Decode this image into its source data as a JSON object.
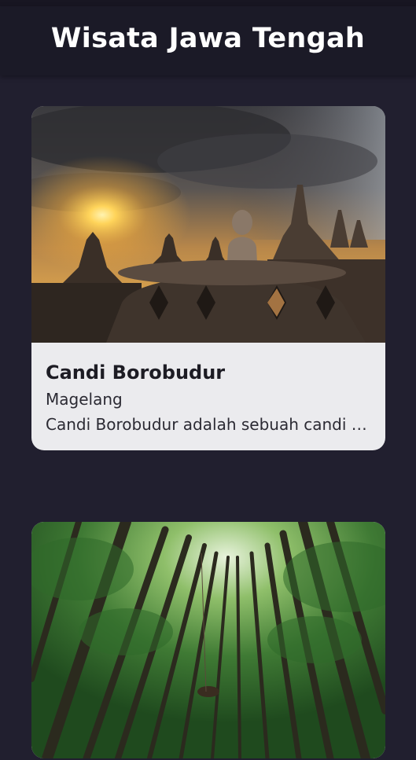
{
  "appbar": {
    "title": "Wisata Jawa Tengah"
  },
  "places": [
    {
      "name": "Candi Borobudur",
      "location": "Magelang",
      "description": "Candi Borobudur adalah sebuah candi Buddha yang terletak di Magelang, Jawa Tengah",
      "image": "borobudur-temple-sunset-photo"
    },
    {
      "image": "pine-forest-swing-photo"
    }
  ],
  "colors": {
    "background": "#211f2f",
    "appbar": "#1b1a27",
    "card": "#ebebee",
    "title_text": "#ffffff"
  }
}
